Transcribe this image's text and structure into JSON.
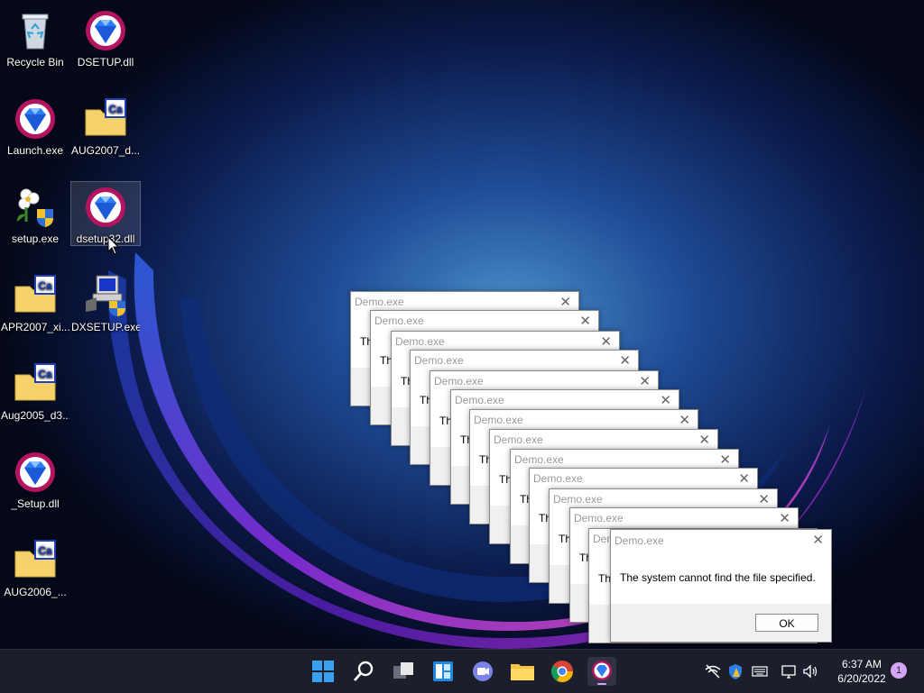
{
  "desktop": {
    "icons": [
      {
        "label": "Recycle Bin",
        "icon": "recycle-bin-icon"
      },
      {
        "label": "DSETUP.dll",
        "icon": "gem-icon"
      },
      {
        "label": "Launch.exe",
        "icon": "gem-icon"
      },
      {
        "label": "AUG2007_d...",
        "icon": "folder-ca-icon"
      },
      {
        "label": "setup.exe",
        "icon": "flower-setup-icon"
      },
      {
        "label": "dsetup32.dll",
        "icon": "gem-icon"
      },
      {
        "label": "APR2007_xi...",
        "icon": "folder-ca-icon"
      },
      {
        "label": "DXSETUP.exe",
        "icon": "computer-setup-icon"
      },
      {
        "label": "Aug2005_d3...",
        "icon": "folder-ca-icon"
      },
      {
        "label": "_Setup.dll",
        "icon": "gem-icon"
      },
      {
        "label": "AUG2006_...",
        "icon": "folder-ca-icon"
      }
    ]
  },
  "dialogs": {
    "stack_title": "Demo.exe",
    "stack_snippets": [
      "Th",
      "Th",
      "Th",
      "Th",
      "Th",
      "Th",
      "Th",
      "Th",
      "Th",
      "Th",
      "Th",
      "Th",
      "Den"
    ],
    "front": {
      "title": "Demo.exe",
      "message": "The system cannot find the file specified.",
      "ok_label": "OK"
    }
  },
  "taskbar": {
    "apps": [
      "windows-start-icon",
      "search-icon",
      "task-view-icon",
      "widgets-icon",
      "teams-chat-icon",
      "file-explorer-icon",
      "chrome-icon",
      "gem-app-icon"
    ],
    "tray": [
      "network-off-icon",
      "defender-icon",
      "keyboard-icon",
      "display-icon",
      "volume-icon"
    ],
    "clock": {
      "time": "6:37 AM",
      "date": "6/20/2022"
    },
    "notification_count": "1"
  },
  "colors": {
    "accent": "#0078d4",
    "taskbar_bg": "#1c1f2b",
    "badge": "#d6a4f7"
  }
}
